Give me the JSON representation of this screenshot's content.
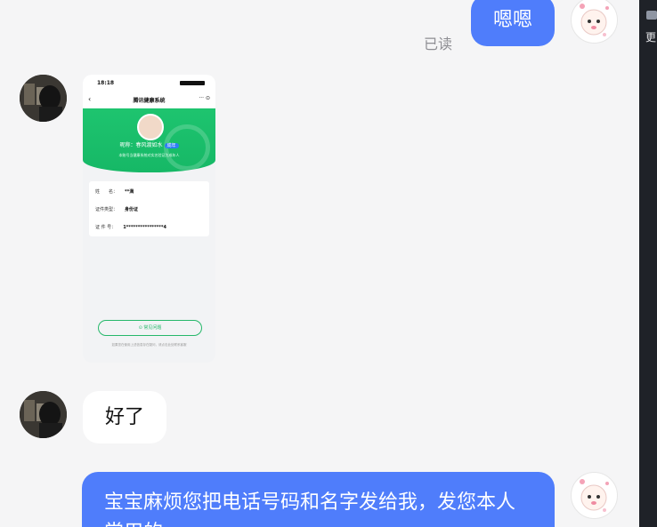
{
  "messages": {
    "top_right_text": "嗯嗯",
    "read_status": "已读",
    "reply_text": "好了",
    "bottom_right_text": "宝宝麻烦您把电话号码和名字发给我，发您本人",
    "bottom_right_text_cut": "常用的"
  },
  "screenshot": {
    "time": "18:18",
    "title": "腾讯健康系统",
    "nickname": "昵称：春风渡如水",
    "nickname_tag": "成年",
    "desc": "本账号当健康系统对实名验证为成年人",
    "rows": [
      {
        "label": "姓　　名：",
        "value": "**满"
      },
      {
        "label": "证件类型：",
        "value": "身份证"
      },
      {
        "label": "证 件 号：",
        "value": "1****************4"
      }
    ],
    "faq": "常见问题",
    "footer": "如果您在使用上述信息存在疑问，请点击此处联系客服"
  },
  "side": {
    "more_label": "更"
  },
  "colors": {
    "blue_bubble": "#4f7dfb",
    "white_bubble": "#ffffff",
    "green_header": "#1ec46f",
    "background": "#f5f5f6"
  }
}
